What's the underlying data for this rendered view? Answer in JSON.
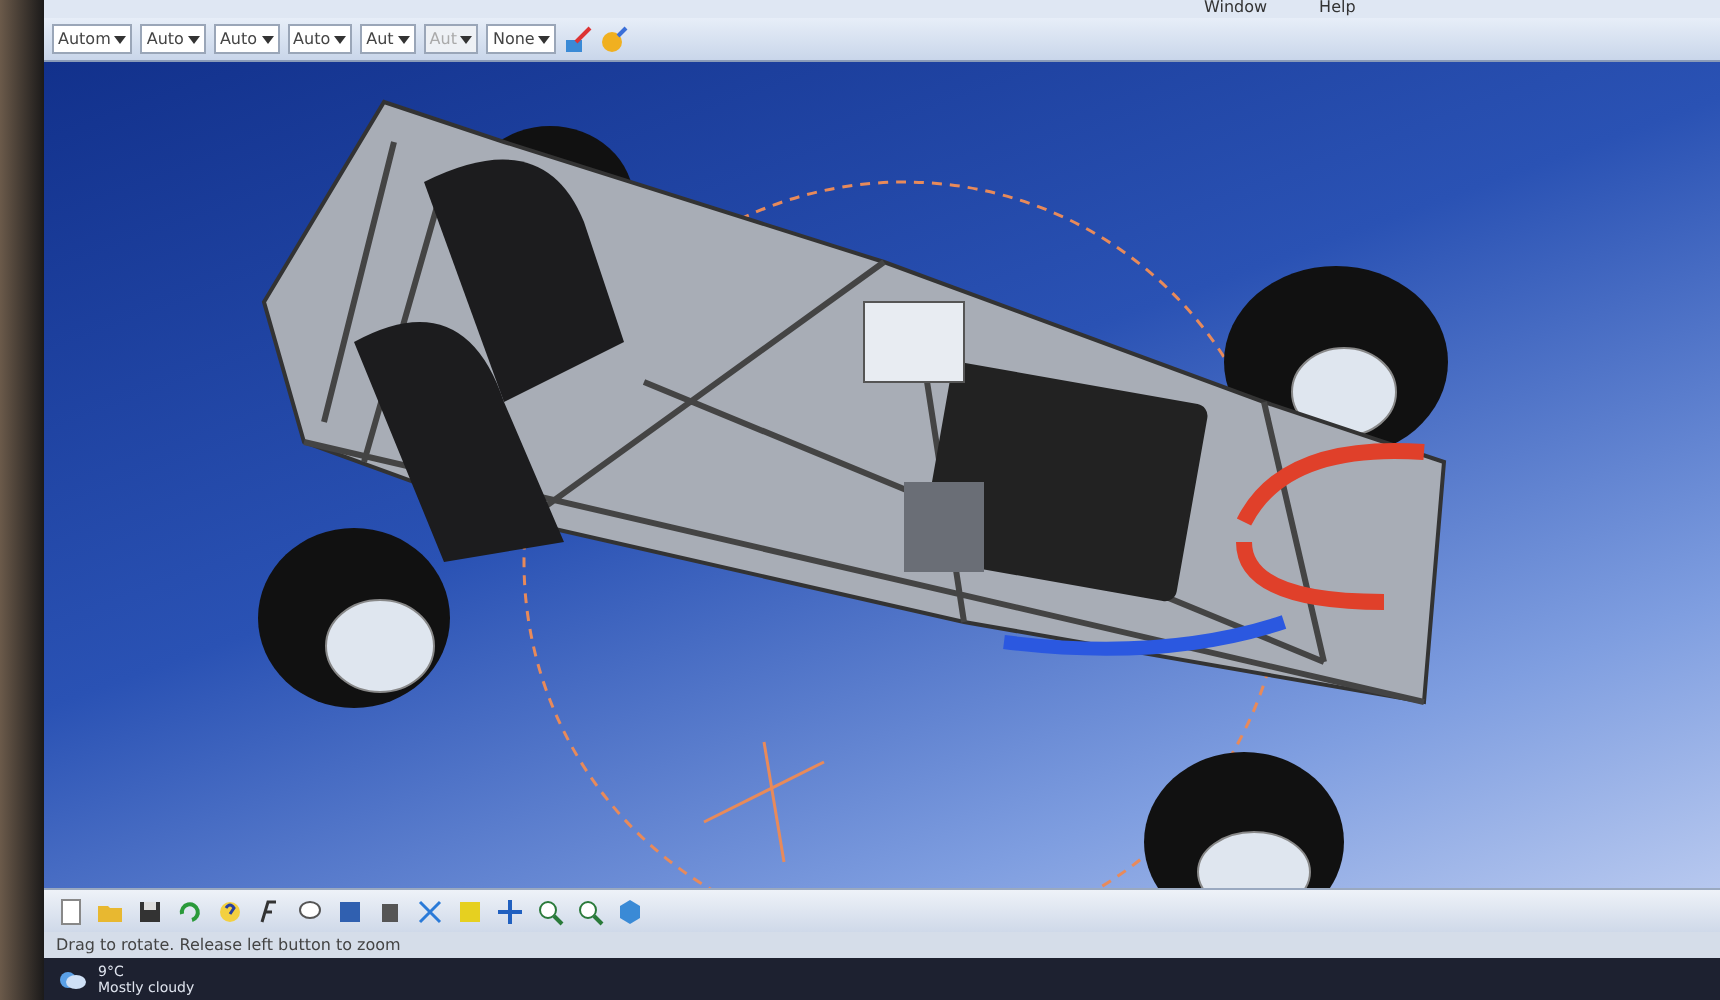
{
  "menu_bar": {
    "items": [
      "Window",
      "Help"
    ]
  },
  "toolbar": {
    "dropdowns": [
      {
        "value": "Autom"
      },
      {
        "value": "Auto"
      },
      {
        "value": "Auto"
      },
      {
        "value": "Auto"
      },
      {
        "value": "Aut"
      },
      {
        "value": "Aut",
        "disabled": true
      },
      {
        "value": "None"
      }
    ]
  },
  "status_bar": {
    "message": "Drag to rotate. Release left button to zoom"
  },
  "taskbar": {
    "weather": {
      "temperature": "9°C",
      "condition": "Mostly cloudy"
    }
  }
}
